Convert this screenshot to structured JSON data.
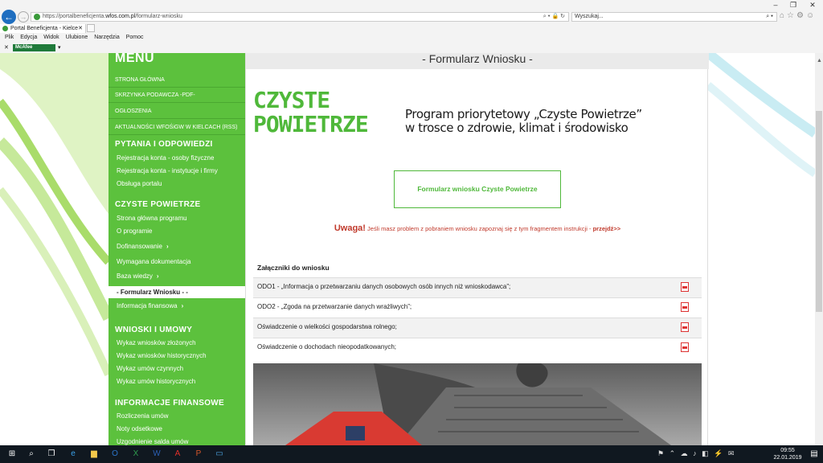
{
  "browser": {
    "address_prefix": "https://portalbeneficjenta.",
    "address_host": "wfos.com.pl",
    "address_path": "/formularz-wniosku",
    "search_placeholder": "Wyszukaj...",
    "tab_title": "Portal Beneficjenta - Kielce",
    "menu": [
      "Plik",
      "Edycja",
      "Widok",
      "Ulubione",
      "Narzędzia",
      "Pomoc"
    ],
    "toolbar_addon": "McAfee"
  },
  "sidebar": {
    "heading": "MENU",
    "top_links": [
      "STRONA GŁÓWNA",
      "SKRZYNKA PODAWCZA -PDF-",
      "OGŁOSZENIA",
      "AKTUALNOŚCI WFOŚiGW W KIELCACH (RSS)"
    ],
    "sections": [
      {
        "title": "PYTANIA I ODPOWIEDZI",
        "items": [
          "Rejestracja konta - osoby fizyczne",
          "Rejestracja konta - instytucje i firmy",
          "Obsługa portalu"
        ]
      },
      {
        "title": "CZYSTE POWIETRZE",
        "items": [
          "Strona główna programu",
          "O programie",
          "Dofinansowanie",
          "Wymagana dokumentacja",
          "Baza wiedzy",
          "- Formularz Wniosku - -",
          "Informacja finansowa"
        ]
      },
      {
        "title": "WNIOSKI I UMOWY",
        "items": [
          "Wykaz wniosków złożonych",
          "Wykaz wniosków historycznych",
          "Wykaz umów czynnych",
          "Wykaz umów historycznych"
        ]
      },
      {
        "title": "INFORMACJE FINANSOWE",
        "items": [
          "Rozliczenia umów",
          "Noty odsetkowe",
          "Uzgodnienie salda umów"
        ]
      }
    ]
  },
  "content": {
    "title": "- Formularz Wniosku -",
    "logo_line1": "CZYSTE",
    "logo_line2": "POWIETRZE",
    "promo_line1": "Program priorytetowy „Czyste Powietrze”",
    "promo_line2": "w trosce o zdrowie, klimat i środowisko",
    "form_button": "Formularz wniosku Czyste Powietrze",
    "warning_label": "Uwaga!",
    "warning_text": " Jeśli masz problem z pobraniem wniosku zapoznaj się z tym fragmentem instrukcji - ",
    "warning_link": "przejdź>>",
    "attachments_heading": "Załączniki do wniosku",
    "attachments": [
      "ODO1 - „Informacja o przetwarzaniu danych osobowych osób innych niż wnioskodawca”;",
      "ODO2 - „Zgoda na przetwarzanie danych wrażliwych”;",
      "Oświadczenie o wielkości gospodarstwa rolnego;",
      "Oświadczenie o dochodach nieopodatkowanych;"
    ]
  },
  "taskbar": {
    "time": "09:55",
    "date": "22.01.2019"
  },
  "colors": {
    "brand_green": "#5cc13d",
    "accent_green": "#4fb83a",
    "warning_red": "#c0392b"
  }
}
